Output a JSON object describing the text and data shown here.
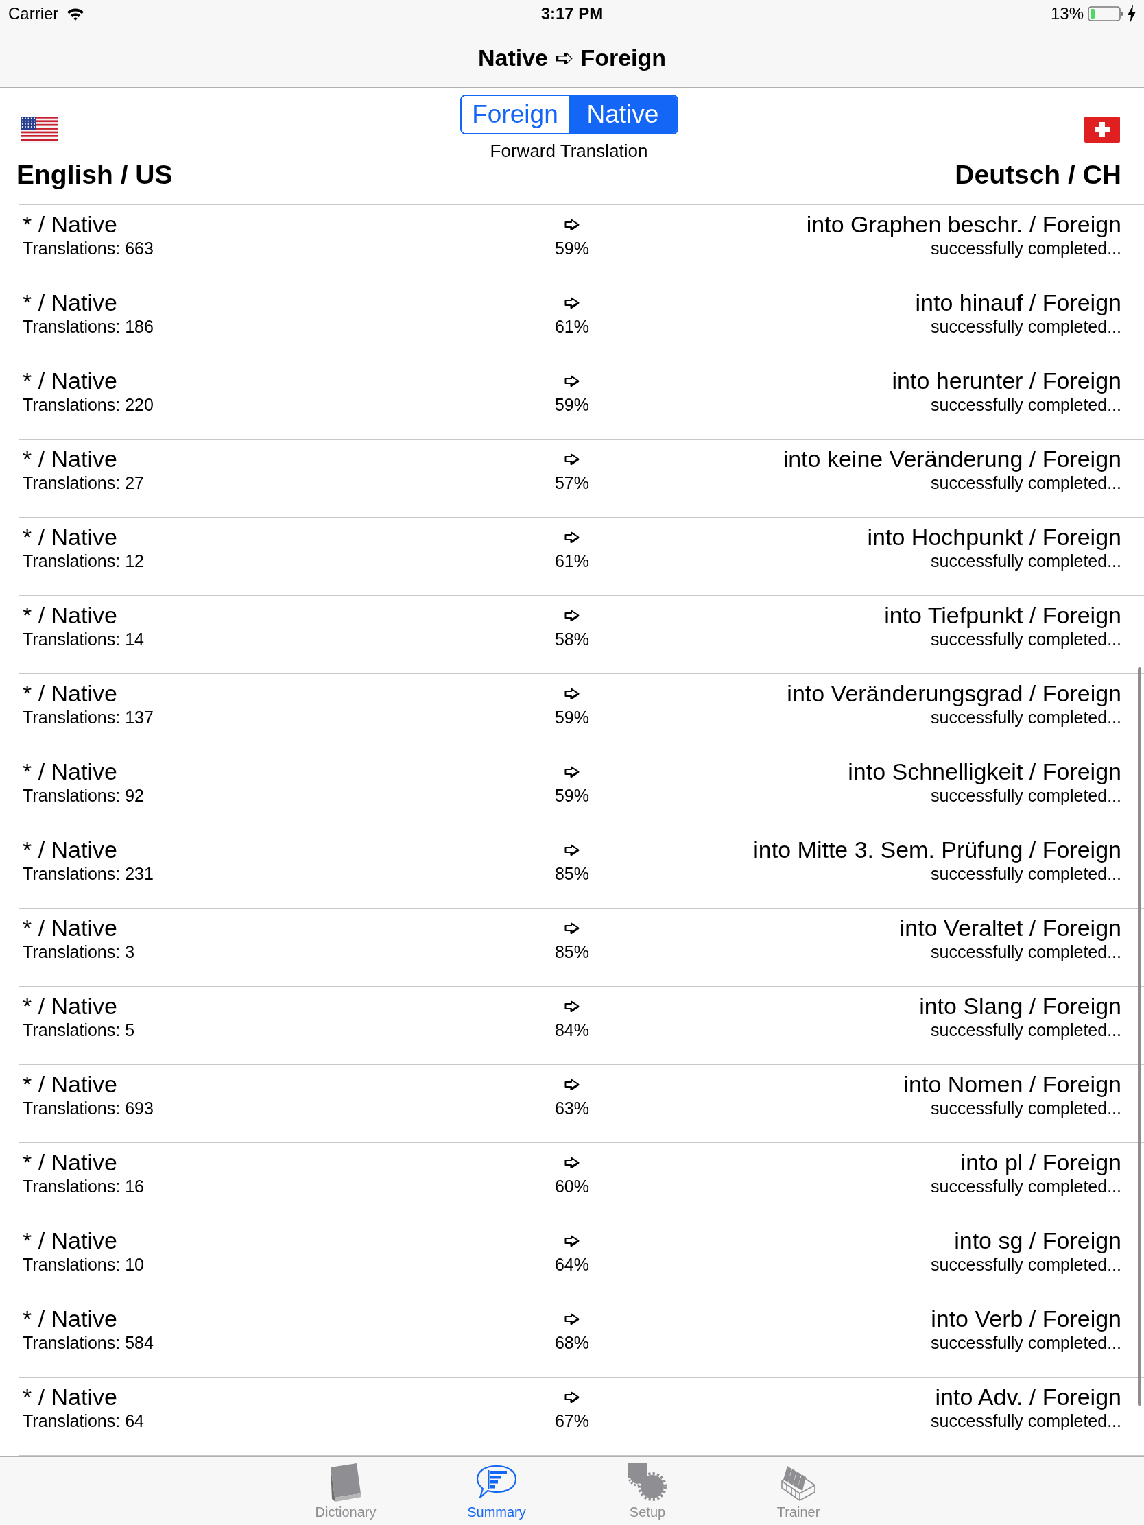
{
  "status_bar": {
    "carrier": "Carrier",
    "time": "3:17 PM",
    "battery": "13%"
  },
  "nav_bar": {
    "title": "Native ➪ Foreign"
  },
  "header": {
    "left_language": "English / US",
    "segments": [
      {
        "label": "Foreign",
        "selected": false
      },
      {
        "label": "Native",
        "selected": true
      }
    ],
    "caption": "Forward Translation",
    "right_language": "Deutsch / CH"
  },
  "rows": [
    {
      "title": "* / Native",
      "translations": "Translations: 663",
      "percent": "59%",
      "target": "into Graphen beschr. / Foreign",
      "status": "successfully completed..."
    },
    {
      "title": "* / Native",
      "translations": "Translations: 186",
      "percent": "61%",
      "target": "into hinauf / Foreign",
      "status": "successfully completed..."
    },
    {
      "title": "* / Native",
      "translations": "Translations: 220",
      "percent": "59%",
      "target": "into herunter / Foreign",
      "status": "successfully completed..."
    },
    {
      "title": "* / Native",
      "translations": "Translations: 27",
      "percent": "57%",
      "target": "into keine Veränderung / Foreign",
      "status": "successfully completed..."
    },
    {
      "title": "* / Native",
      "translations": "Translations: 12",
      "percent": "61%",
      "target": "into Hochpunkt / Foreign",
      "status": "successfully completed..."
    },
    {
      "title": "* / Native",
      "translations": "Translations: 14",
      "percent": "58%",
      "target": "into Tiefpunkt / Foreign",
      "status": "successfully completed..."
    },
    {
      "title": "* / Native",
      "translations": "Translations: 137",
      "percent": "59%",
      "target": "into Veränderungsgrad / Foreign",
      "status": "successfully completed..."
    },
    {
      "title": "* / Native",
      "translations": "Translations: 92",
      "percent": "59%",
      "target": "into Schnelligkeit / Foreign",
      "status": "successfully completed..."
    },
    {
      "title": "* / Native",
      "translations": "Translations: 231",
      "percent": "85%",
      "target": "into Mitte 3. Sem. Prüfung / Foreign",
      "status": "successfully completed..."
    },
    {
      "title": "* / Native",
      "translations": "Translations: 3",
      "percent": "85%",
      "target": "into Veraltet / Foreign",
      "status": "successfully completed..."
    },
    {
      "title": "* / Native",
      "translations": "Translations: 5",
      "percent": "84%",
      "target": "into Slang / Foreign",
      "status": "successfully completed..."
    },
    {
      "title": "* / Native",
      "translations": "Translations: 693",
      "percent": "63%",
      "target": "into Nomen / Foreign",
      "status": "successfully completed..."
    },
    {
      "title": "* / Native",
      "translations": "Translations: 16",
      "percent": "60%",
      "target": "into pl / Foreign",
      "status": "successfully completed..."
    },
    {
      "title": "* / Native",
      "translations": "Translations: 10",
      "percent": "64%",
      "target": "into sg / Foreign",
      "status": "successfully completed..."
    },
    {
      "title": "* / Native",
      "translations": "Translations: 584",
      "percent": "68%",
      "target": "into Verb / Foreign",
      "status": "successfully completed..."
    },
    {
      "title": "* / Native",
      "translations": "Translations: 64",
      "percent": "67%",
      "target": "into Adv. / Foreign",
      "status": "successfully completed..."
    }
  ],
  "tab_bar": {
    "items": [
      {
        "label": "Dictionary",
        "selected": false
      },
      {
        "label": "Summary",
        "selected": true
      },
      {
        "label": "Setup",
        "selected": false
      },
      {
        "label": "Trainer",
        "selected": false
      }
    ]
  }
}
